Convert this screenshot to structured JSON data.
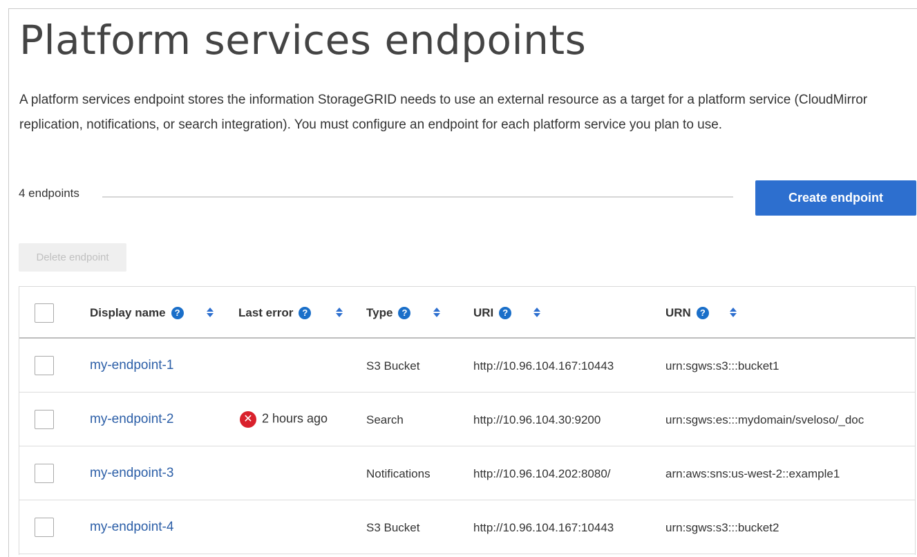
{
  "page": {
    "title": "Platform services endpoints",
    "description": "A platform services endpoint stores the information StorageGRID needs to use an external resource as a target for a platform service (CloudMirror replication, notifications, or search integration). You must configure an endpoint for each platform service you plan to use."
  },
  "toolbar": {
    "count_label": "4 endpoints",
    "create_label": "Create endpoint",
    "delete_label": "Delete endpoint"
  },
  "table": {
    "columns": [
      "Display name",
      "Last error",
      "Type",
      "URI",
      "URN"
    ],
    "rows": [
      {
        "name": "my-endpoint-1",
        "last_error": "",
        "type": "S3 Bucket",
        "uri": "http://10.96.104.167:10443",
        "urn": "urn:sgws:s3:::bucket1"
      },
      {
        "name": "my-endpoint-2",
        "last_error": "2 hours ago",
        "type": "Search",
        "uri": "http://10.96.104.30:9200",
        "urn": "urn:sgws:es:::mydomain/sveloso/_doc"
      },
      {
        "name": "my-endpoint-3",
        "last_error": "",
        "type": "Notifications",
        "uri": "http://10.96.104.202:8080/",
        "urn": "arn:aws:sns:us-west-2::example1"
      },
      {
        "name": "my-endpoint-4",
        "last_error": "",
        "type": "S3 Bucket",
        "uri": "http://10.96.104.167:10443",
        "urn": "urn:sgws:s3:::bucket2"
      }
    ]
  },
  "icons": {
    "help": "help-icon",
    "sort": "sort-icon",
    "error": "error-icon"
  },
  "colors": {
    "accent": "#2d6fcf",
    "link": "#2b5ea7",
    "error": "#d9212c"
  }
}
